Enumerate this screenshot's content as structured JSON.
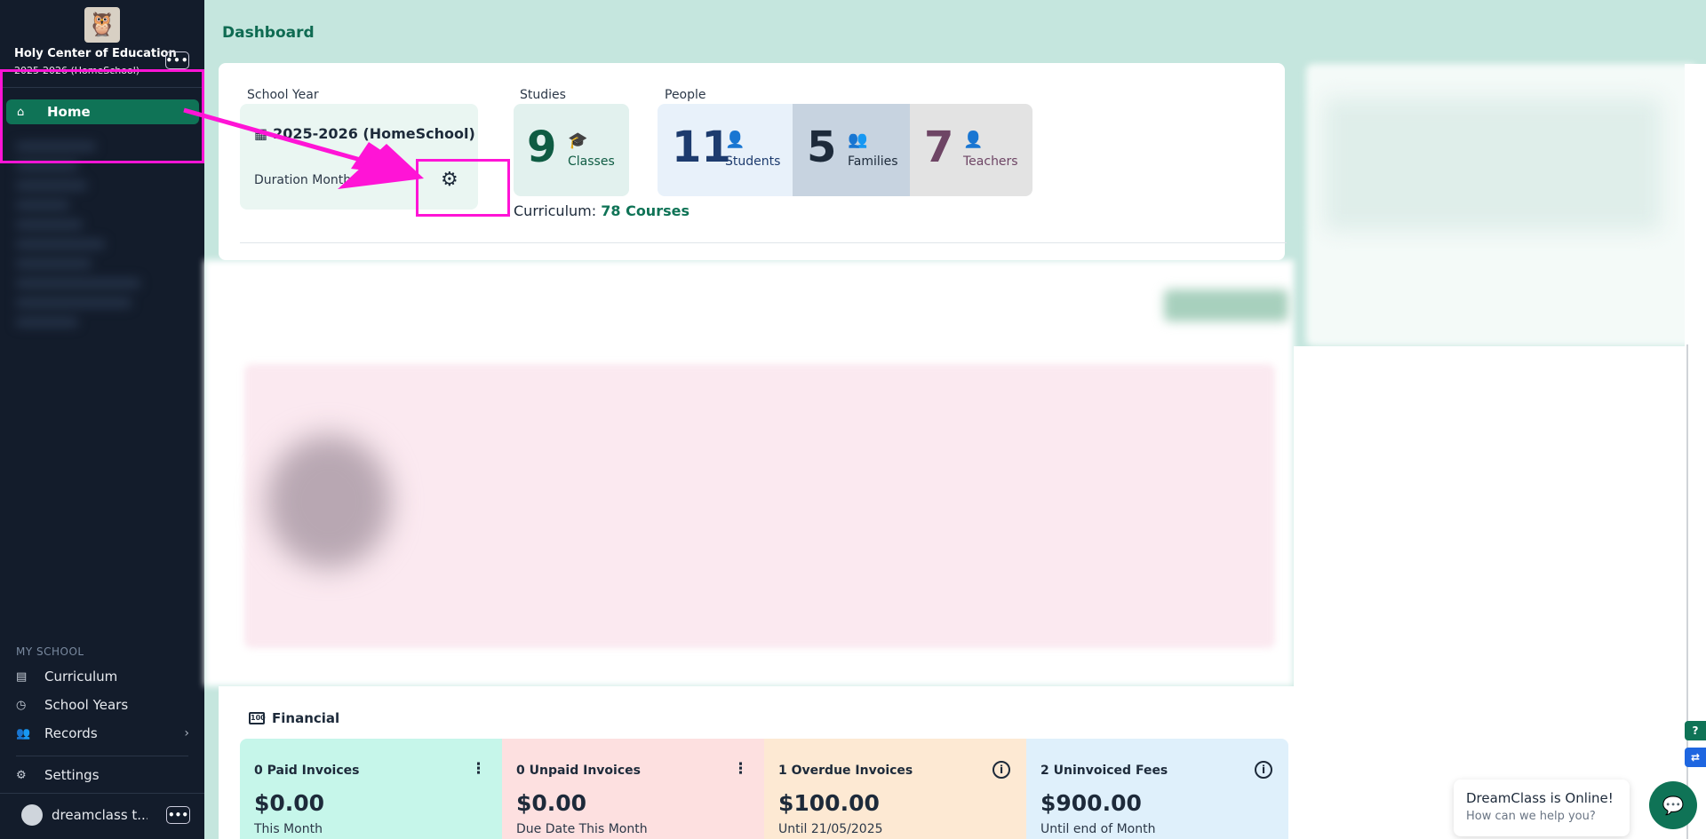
{
  "sidebar": {
    "logo_icon": "owl-icon",
    "school_name": "Holy Center of Education",
    "school_year": "2025-2026 (HomeSchool)",
    "more_label": "•••",
    "home_label": "Home",
    "section_label": "MY SCHOOL",
    "items": [
      {
        "label": "Curriculum",
        "icon": "book-icon"
      },
      {
        "label": "School Years",
        "icon": "clock-icon"
      },
      {
        "label": "Records",
        "icon": "users-icon"
      },
      {
        "label": "Settings",
        "icon": "gear-icon"
      }
    ],
    "user_name": "dreamclass t...",
    "user_more": "•••"
  },
  "header": {
    "title": "Dashboard"
  },
  "school_year": {
    "group_label": "School Year",
    "title": "2025-2026 (HomeSchool)",
    "duration_label": "Duration Months"
  },
  "studies": {
    "group_label": "Studies",
    "classes_count": "9",
    "classes_label": "Classes"
  },
  "people": {
    "group_label": "People",
    "students_count": "11",
    "students_label": "Students",
    "families_count": "5",
    "families_label": "Families",
    "teachers_count": "7",
    "teachers_label": "Teachers"
  },
  "curriculum": {
    "prefix": "Curriculum:",
    "courses": "78 Courses"
  },
  "financial": {
    "title": "Financial",
    "icon_text": "100",
    "cards": [
      {
        "label": "0 Paid Invoices",
        "amount": "$0.00",
        "sub": "This Month",
        "color": "#c6f6ea"
      },
      {
        "label": "0 Unpaid Invoices",
        "amount": "$0.00",
        "sub": "Due Date This Month",
        "color": "#fde0e0"
      },
      {
        "label": "1 Overdue Invoices",
        "amount": "$100.00",
        "sub": "Until 21/05/2025",
        "color": "#fde9d3"
      },
      {
        "label": "2 Uninvoiced Fees",
        "amount": "$900.00",
        "sub": "Until end of Month",
        "color": "#dff0fb"
      }
    ]
  },
  "chat": {
    "title": "DreamClass is Online!",
    "subtitle": "How can we help you?"
  },
  "side_tabs": {
    "help": "?"
  },
  "colors": {
    "accent": "#0f7356",
    "highlight": "#ff14d6",
    "sidebar_bg": "#131c2b"
  }
}
